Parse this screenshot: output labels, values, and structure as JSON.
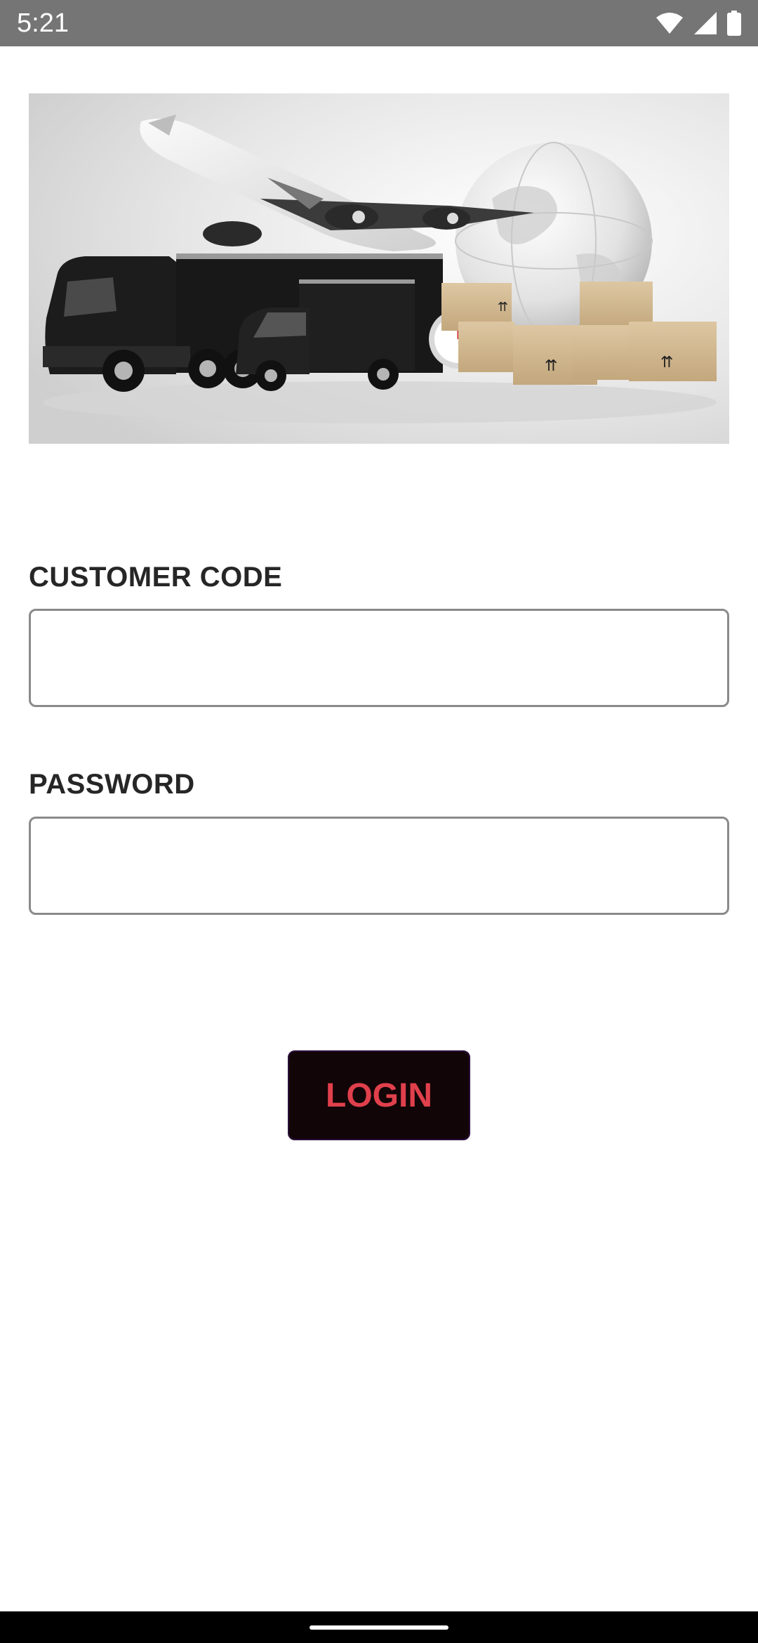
{
  "status_bar": {
    "time": "5:21",
    "icons": [
      "wifi-icon",
      "cellular-signal-icon",
      "battery-icon"
    ]
  },
  "hero": {
    "image": "logistics-hero-image",
    "elements": [
      "truck",
      "van",
      "airplane",
      "globe",
      "stopwatch",
      "cardboard-boxes"
    ]
  },
  "form": {
    "customer_code_label": "CUSTOMER CODE",
    "customer_code_value": "",
    "password_label": "PASSWORD",
    "password_value": "",
    "login_label": "LOGIN"
  },
  "colors": {
    "status_bar_bg": "#757575",
    "login_button_bg": "#120507",
    "login_button_text": "#e0404c",
    "label_text": "#262626",
    "input_border": "#8a8a8a"
  }
}
